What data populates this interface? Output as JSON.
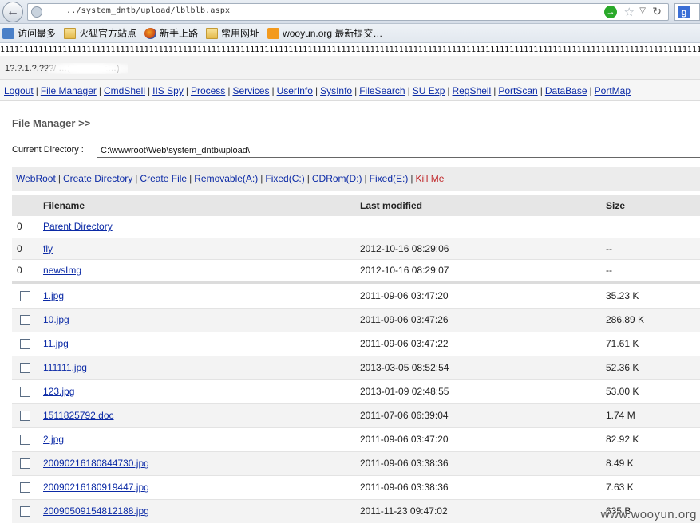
{
  "browser": {
    "url": "../system_dntb/upload/lblblb.aspx",
    "bookmarks": [
      {
        "label": "访问最多",
        "icon": "visits-icon"
      },
      {
        "label": "火狐官方站点",
        "icon": "folder-icon"
      },
      {
        "label": "新手上路",
        "icon": "firefox-icon"
      },
      {
        "label": "常用网址",
        "icon": "folder-icon"
      },
      {
        "label": "wooyun.org 最新提交…",
        "icon": "rss-icon"
      }
    ],
    "search_engine_letter": "g"
  },
  "page": {
    "ones_line": "1111111111111111111111111111111111111111111111111111111111111111111111111111111111111111111111111111111111111111111111111111111111111111111111111111",
    "ip_text": "1?.?.1.?.???/ …(www.com…)",
    "menu": [
      "Logout",
      "File Manager",
      "CmdShell",
      "IIS Spy",
      "Process",
      "Services",
      "UserInfo",
      "SysInfo",
      "FileSearch",
      "SU Exp",
      "RegShell",
      "PortScan",
      "DataBase",
      "PortMap"
    ],
    "fm_title": "File Manager >>",
    "current_directory_label": "Current Directory :",
    "current_directory_value": "C:\\wwwroot\\Web\\system_dntb\\upload\\",
    "actions": [
      "WebRoot",
      "Create Directory",
      "Create File",
      "Removable(A:)",
      "Fixed(C:)",
      "CDRom(D:)",
      "Fixed(E:)",
      "Kill Me"
    ],
    "columns": {
      "filename": "Filename",
      "modified": "Last modified",
      "size": "Size"
    },
    "dirs": [
      {
        "marker": "0",
        "name": "Parent Directory",
        "modified": "",
        "size": ""
      },
      {
        "marker": "0",
        "name": "fly",
        "modified": "2012-10-16 08:29:06",
        "size": "--"
      },
      {
        "marker": "0",
        "name": "newsImg",
        "modified": "2012-10-16 08:29:07",
        "size": "--"
      }
    ],
    "files": [
      {
        "name": "1.jpg",
        "modified": "2011-09-06 03:47:20",
        "size": "35.23 K"
      },
      {
        "name": "10.jpg",
        "modified": "2011-09-06 03:47:26",
        "size": "286.89 K"
      },
      {
        "name": "11.jpg",
        "modified": "2011-09-06 03:47:22",
        "size": "71.61 K"
      },
      {
        "name": "111111.jpg",
        "modified": "2013-03-05 08:52:54",
        "size": "52.36 K"
      },
      {
        "name": "123.jpg",
        "modified": "2013-01-09 02:48:55",
        "size": "53.00 K"
      },
      {
        "name": "1511825792.doc",
        "modified": "2011-07-06 06:39:04",
        "size": "1.74 M"
      },
      {
        "name": "2.jpg",
        "modified": "2011-09-06 03:47:20",
        "size": "82.92 K"
      },
      {
        "name": "20090216180844730.jpg",
        "modified": "2011-09-06 03:38:36",
        "size": "8.49 K"
      },
      {
        "name": "20090216180919447.jpg",
        "modified": "2011-09-06 03:38:36",
        "size": "7.63 K"
      },
      {
        "name": "20090509154812188.jpg",
        "modified": "2011-11-23 09:47:02",
        "size": "635 B"
      }
    ],
    "watermark": "www.wooyun.org"
  }
}
